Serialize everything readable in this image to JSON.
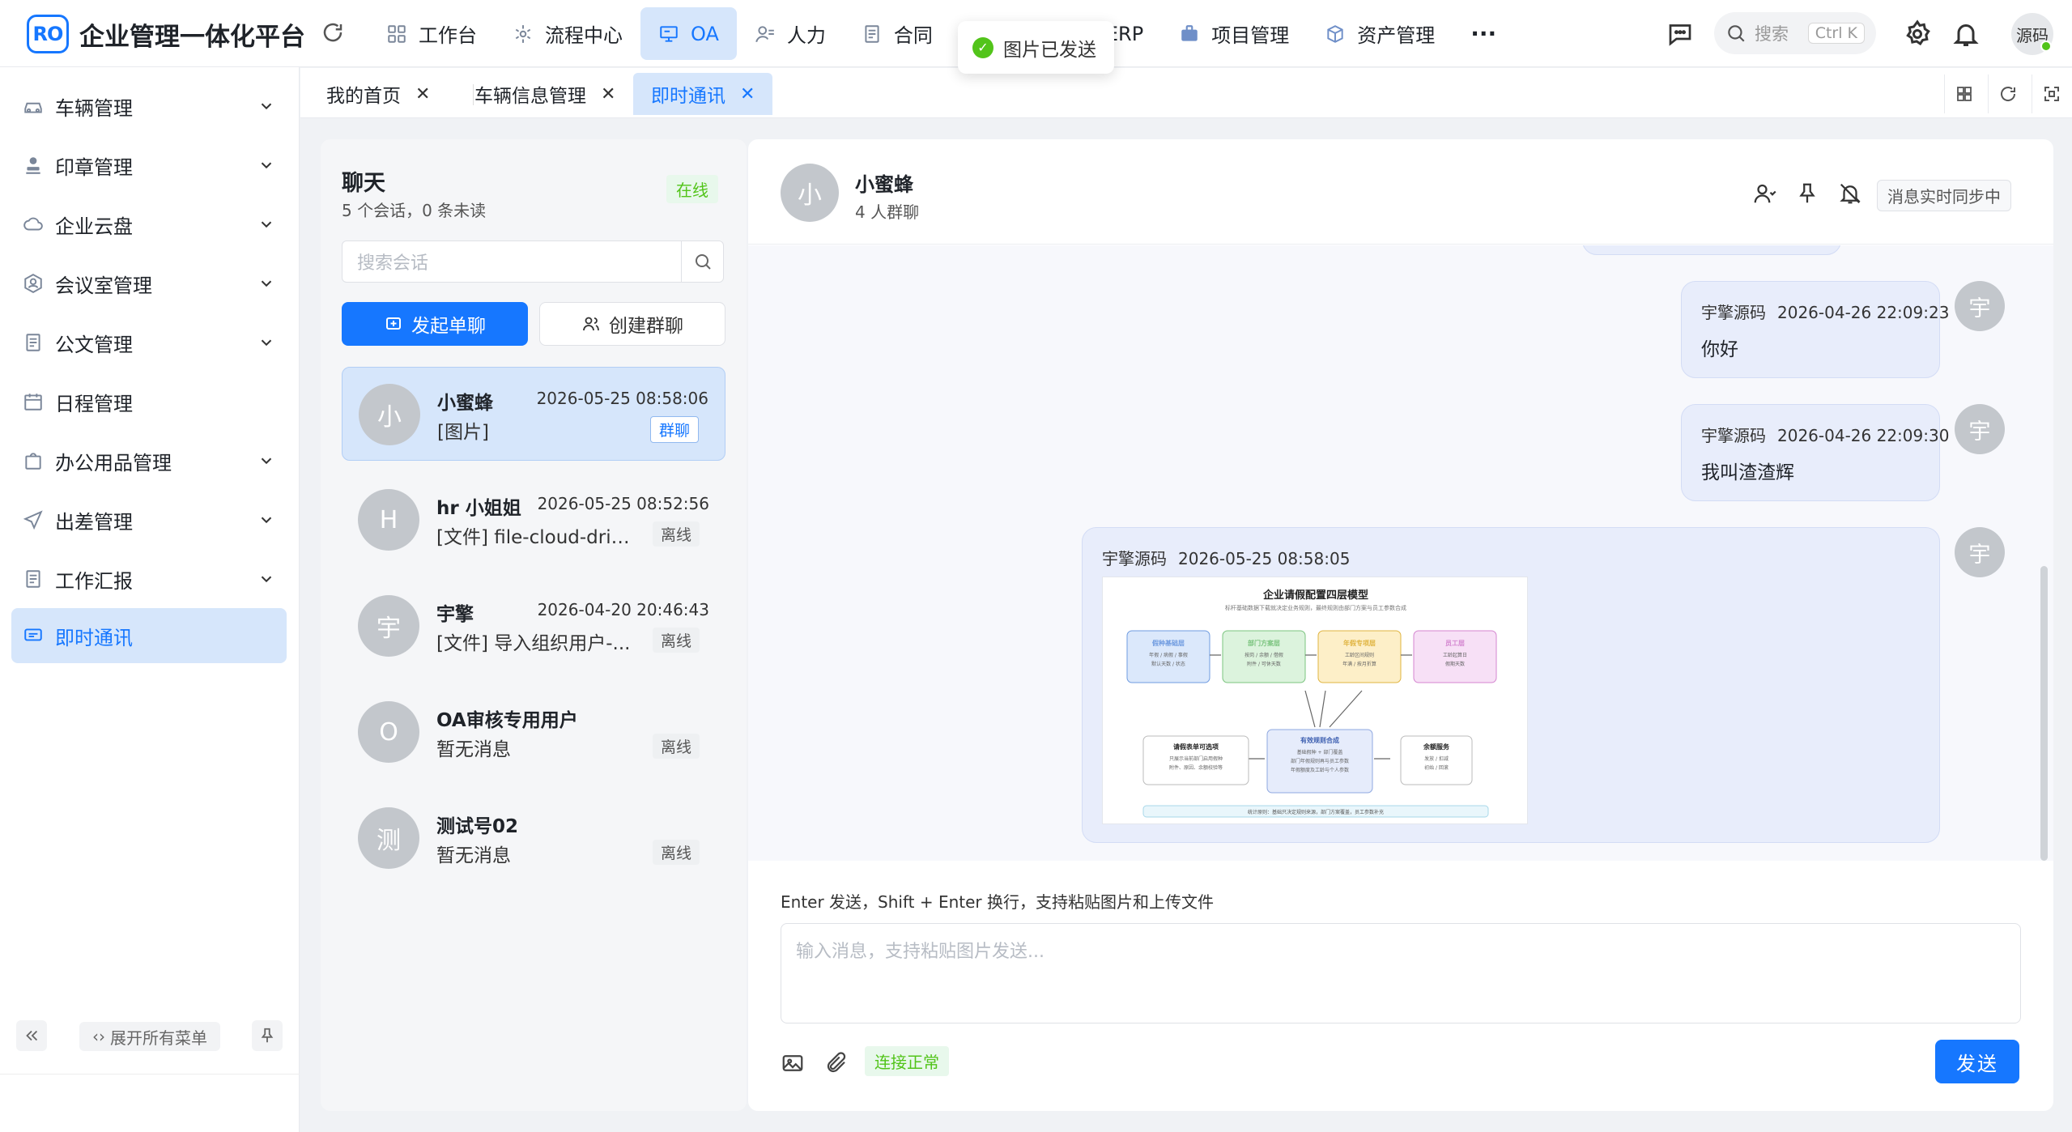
{
  "app": {
    "logo": "RO",
    "title": "企业管理一体化平台"
  },
  "nav": [
    {
      "label": "工作台",
      "icon": "workbench-icon"
    },
    {
      "label": "流程中心",
      "icon": "flow-icon"
    },
    {
      "label": "OA",
      "icon": "oa-icon"
    },
    {
      "label": "人力",
      "icon": "user-icon"
    },
    {
      "label": "合同",
      "icon": "contract-icon"
    },
    {
      "label": "ERP",
      "icon": "erp-icon"
    },
    {
      "label": "项目管理",
      "icon": "briefcase-icon"
    },
    {
      "label": "资产管理",
      "icon": "asset-icon"
    }
  ],
  "nav_more": "···",
  "search": {
    "placeholder": "搜索",
    "shortcut": "Ctrl K"
  },
  "user": {
    "name": "源码"
  },
  "toast": {
    "text": "图片已发送"
  },
  "sidebar": {
    "items": [
      {
        "label": "车辆管理"
      },
      {
        "label": "印章管理"
      },
      {
        "label": "企业云盘"
      },
      {
        "label": "会议室管理"
      },
      {
        "label": "公文管理"
      },
      {
        "label": "日程管理"
      },
      {
        "label": "办公用品管理"
      },
      {
        "label": "出差管理"
      },
      {
        "label": "工作汇报"
      },
      {
        "label": "即时通讯"
      }
    ],
    "expand_all": "展开所有菜单"
  },
  "tabs": [
    {
      "label": "我的首页"
    },
    {
      "label": "车辆信息管理"
    },
    {
      "label": "即时通讯"
    }
  ],
  "chat_list": {
    "title": "聊天",
    "summary": "5 个会话，0 条未读",
    "status": "在线",
    "search_placeholder": "搜索会话",
    "new_chat": "发起单聊",
    "new_group": "创建群聊",
    "conversations": [
      {
        "avatar": "小",
        "name": "小蜜蜂",
        "time": "2026-05-25 08:58:06",
        "preview": "[图片]",
        "tag": "群聊"
      },
      {
        "avatar": "H",
        "name": "hr 小姐姐",
        "time": "2026-05-25 08:52:56",
        "preview": "[文件] file-cloud-drive...",
        "tag": "离线"
      },
      {
        "avatar": "宇",
        "name": "宇擎",
        "time": "2026-04-20 20:46:43",
        "preview": "[文件] 导入组织用户-...",
        "tag": "离线"
      },
      {
        "avatar": "O",
        "name": "OA审核专用用户",
        "time": "",
        "preview": "暂无消息",
        "tag": "离线"
      },
      {
        "avatar": "测",
        "name": "测试号02",
        "time": "",
        "preview": "暂无消息",
        "tag": "离线"
      }
    ]
  },
  "chat": {
    "avatar": "小",
    "name": "小蜜蜂",
    "subtitle": "4 人群聊",
    "sync_status": "消息实时同步中",
    "messages": [
      {
        "sender": "宇擎源码",
        "time": "2026-04-26 22:09:23",
        "text": "你好",
        "avatar": "宇"
      },
      {
        "sender": "宇擎源码",
        "time": "2026-04-26 22:09:30",
        "text": "我叫渣渣辉",
        "avatar": "宇"
      },
      {
        "sender": "宇擎源码",
        "time": "2026-05-25 08:58:05",
        "text": "",
        "avatar": "宇"
      }
    ],
    "image": {
      "title": "企业请假配置四层模型",
      "subtitle": "标杆基础数据下载就决定业务规则，最终规则由部门方案与员工参数合成",
      "layers": [
        {
          "title": "假种基础层",
          "lines": [
            "年假 / 病假 / 事假",
            "默认天数 / 状态"
          ],
          "color": "#dbe8fb",
          "border": "#6f9be0"
        },
        {
          "title": "部门方案层",
          "lines": [
            "按岗 / 余额 / 借假",
            "附件 / 可休天数"
          ],
          "color": "#dcf3dd",
          "border": "#7bc47f"
        },
        {
          "title": "年假专项层",
          "lines": [
            "工龄区间规则",
            "年满 / 按月折算"
          ],
          "color": "#fdefc8",
          "border": "#e0b440"
        },
        {
          "title": "员工层",
          "lines": [
            "工龄起算日",
            "假期天数"
          ],
          "color": "#f7e0f6",
          "border": "#d486d0"
        }
      ],
      "bottom": [
        {
          "title": "请假表单可选项",
          "lines": [
            "只展示当前部门启用假种",
            "附件、原因、余额校验等"
          ]
        },
        {
          "title": "有效规则合成",
          "lines": [
            "基础假种 + 部门覆盖",
            "部门年假规则再与员工参数",
            "年假额度及工龄与个人参数"
          ]
        },
        {
          "title": "余额服务",
          "lines": [
            "发放 / 扣减",
            "初始 / 回滚"
          ]
        }
      ],
      "footer": "统计原则：基础只决定规则来源，部门方案覆盖，员工参数补充"
    },
    "hint": "Enter 发送，Shift + Enter 换行，支持粘贴图片和上传文件",
    "input_placeholder": "输入消息，支持粘贴图片发送...",
    "connection": "连接正常",
    "send": "发送"
  },
  "colors": {
    "primary": "#1677ff",
    "active_bg": "#d6e6fb",
    "success": "#52c41a"
  }
}
